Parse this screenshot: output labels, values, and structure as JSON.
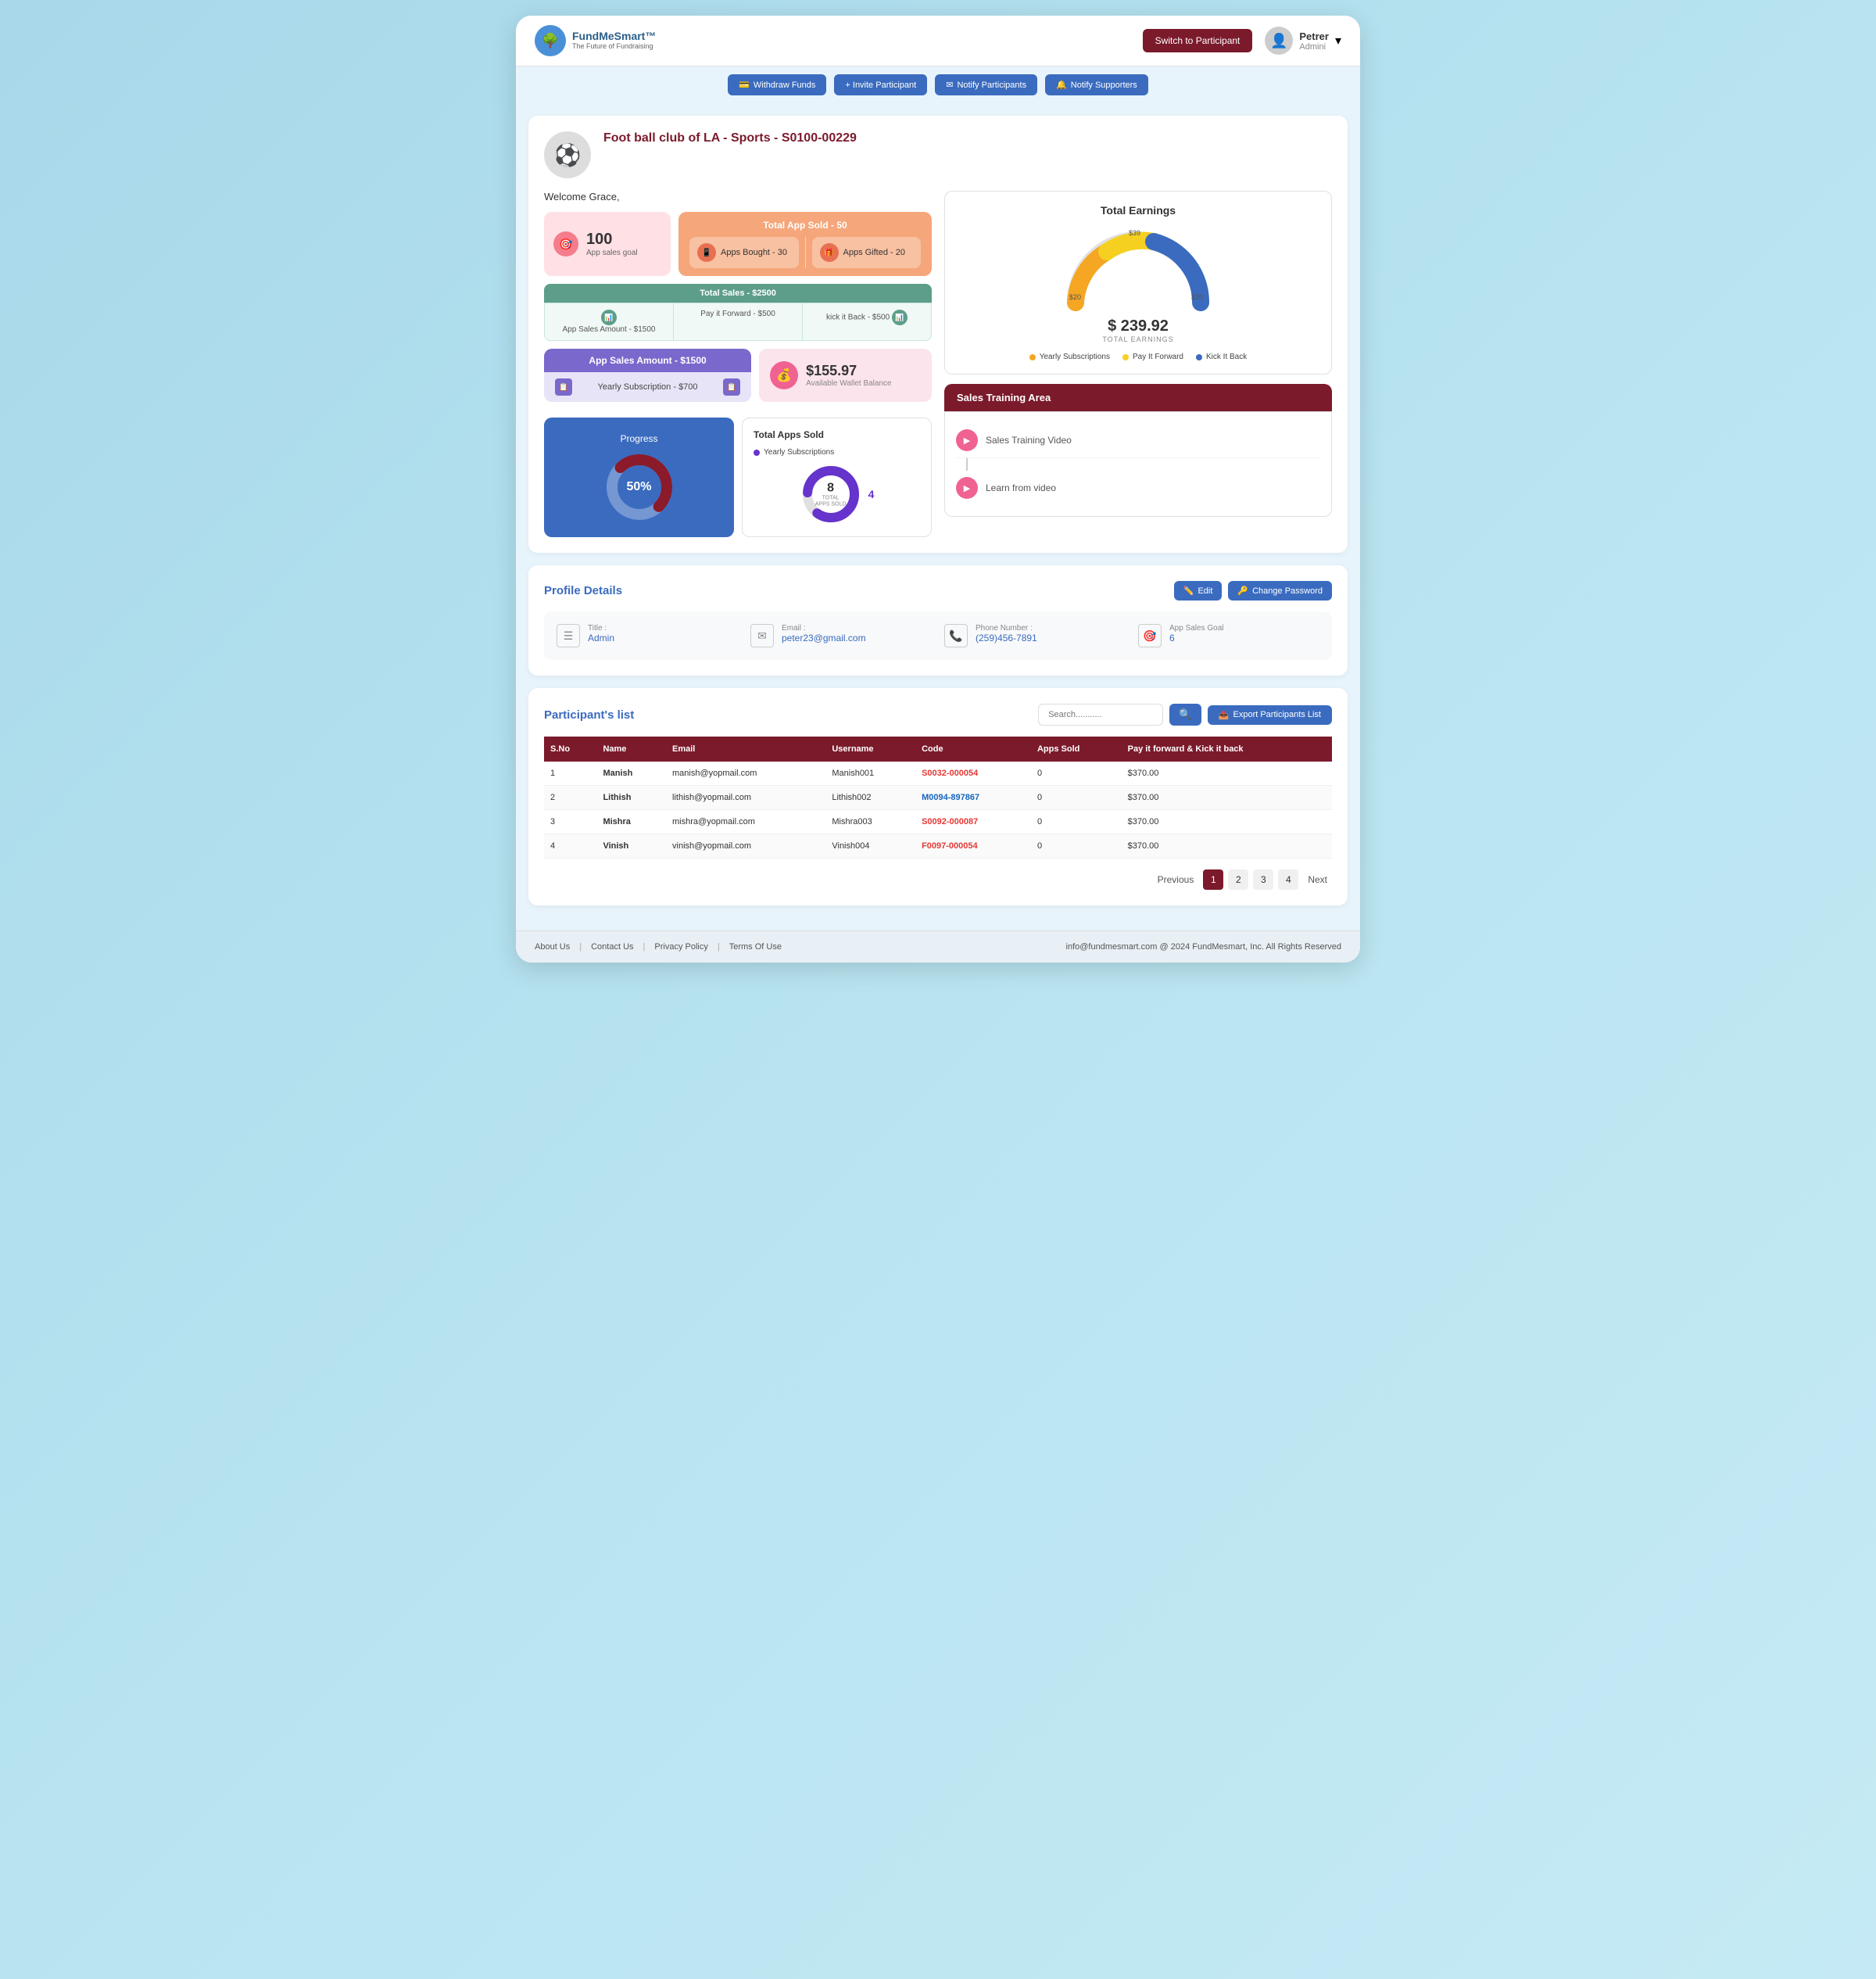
{
  "nav": {
    "brand": "FundMeSmart™",
    "tagline": "The Future of Fundraising",
    "switch_btn": "Switch to Participant",
    "user_name": "Petrer",
    "user_role": "Admini"
  },
  "action_bar": {
    "btn1": "Withdraw Funds",
    "btn2": "+ Invite Participant",
    "btn3": "Notify Participants",
    "btn4": "Notify Supporters"
  },
  "campaign": {
    "title": "Foot ball club of LA -  Sports - ",
    "code": "S0100-00229",
    "welcome": "Welcome Grace,"
  },
  "stats": {
    "goal_num": "100",
    "goal_label": "App sales goal",
    "apps_sold_title": "Total App Sold - 50",
    "apps_bought": "Apps Bought - 30",
    "apps_gifted": "Apps Gifted - 20",
    "total_sales_label": "Total Sales - $2500",
    "app_sales_amount": "App Sales Amount - $1500",
    "pay_it_forward": "Pay it Forward - $500",
    "kick_it_back": "kick it Back - $500",
    "app_sales_section": "App Sales Amount - $1500",
    "yearly_sub": "Yearly Subscription - $700",
    "wallet_amount": "$155.97",
    "wallet_label": "Available Wallet Balance"
  },
  "progress": {
    "label": "Progress",
    "percent": "50%"
  },
  "total_apps": {
    "title": "Total Apps Sold",
    "center_num": "8",
    "center_label": "TOTAL APPS SOLD",
    "legend_yearly": "Yearly Subscriptions",
    "legend_num": "4"
  },
  "earnings": {
    "title": "Total Earnings",
    "amount": "$ 239.92",
    "label": "TOTAL EARNINGS",
    "val_left": "$20",
    "val_top": "$39",
    "val_right": "$20",
    "legend": [
      {
        "label": "Yearly Subscriptions",
        "color": "#f5a623"
      },
      {
        "label": "Pay It Forward",
        "color": "#f5d020"
      },
      {
        "label": "Kick It Back",
        "color": "#3a6bbf"
      }
    ]
  },
  "training": {
    "header": "Sales Training Area",
    "item1": "Sales Training Video",
    "item2": "Learn from video"
  },
  "profile": {
    "section_title": "Profile Details",
    "edit_btn": "Edit",
    "change_pwd_btn": "Change Password",
    "title_label": "Title :",
    "title_value": "Admin",
    "email_label": "Email :",
    "email_value": "peter23@gmail.com",
    "phone_label": "Phone Number :",
    "phone_value": "(259)456-7891",
    "goal_label": "App Sales Goal",
    "goal_value": "6"
  },
  "participants": {
    "section_title": "Participant's list",
    "search_placeholder": "Search...........",
    "export_btn": "Export Participants List",
    "columns": [
      "S.No",
      "Name",
      "Email",
      "Username",
      "Code",
      "Apps Sold",
      "Pay it forward  &  Kick it back"
    ],
    "rows": [
      {
        "sno": "1",
        "name": "Manish",
        "email": "manish@yopmail.com",
        "username": "Manish001",
        "code": "S0032-000054",
        "apps_sold": "0",
        "payback": "$370.00",
        "code_color": "red"
      },
      {
        "sno": "2",
        "name": "Lithish",
        "email": "lithish@yopmail.com",
        "username": "Lithish002",
        "code": "M0094-897867",
        "apps_sold": "0",
        "payback": "$370.00",
        "code_color": "blue"
      },
      {
        "sno": "3",
        "name": "Mishra",
        "email": "mishra@yopmail.com",
        "username": "Mishra003",
        "code": "S0092-000087",
        "apps_sold": "0",
        "payback": "$370.00",
        "code_color": "red"
      },
      {
        "sno": "4",
        "name": "Vinish",
        "email": "vinish@yopmail.com",
        "username": "Vinish004",
        "code": "F0097-000054",
        "apps_sold": "0",
        "payback": "$370.00",
        "code_color": "red"
      }
    ],
    "pagination": {
      "previous": "Previous",
      "pages": [
        "1",
        "2",
        "3",
        "4"
      ],
      "next": "Next",
      "active": "1"
    }
  },
  "footer": {
    "links": [
      "About Us",
      "Contact Us",
      "Privacy Policy",
      "Terms Of Use"
    ],
    "right_text": "info@fundmesmart.com  @ 2024 FundMesmart, Inc.   All Rights Reserved"
  }
}
